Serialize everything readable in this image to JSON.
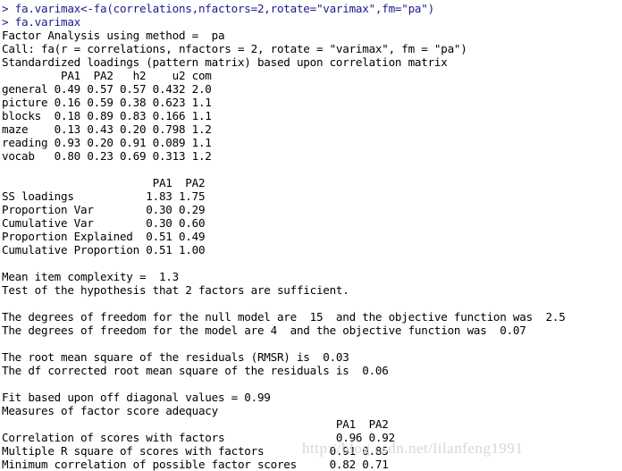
{
  "console": {
    "background_color": "#ffffff",
    "prompt_color": "#1a1a8c",
    "output_color": "#000000",
    "lines": [
      {
        "text": "> fa.varimax<-fa(correlations,nfactors=2,rotate=\"varimax\",fm=\"pa\")",
        "type": "prompt"
      },
      {
        "text": "> fa.varimax",
        "type": "prompt"
      },
      {
        "text": "Factor Analysis using method =  pa",
        "type": "output"
      },
      {
        "text": "Call: fa(r = correlations, nfactors = 2, rotate = \"varimax\", fm = \"pa\")",
        "type": "output"
      },
      {
        "text": "Standardized loadings (pattern matrix) based upon correlation matrix",
        "type": "output"
      },
      {
        "text": "         PA1  PA2   h2    u2 com",
        "type": "output"
      },
      {
        "text": "general 0.49 0.57 0.57 0.432 2.0",
        "type": "output"
      },
      {
        "text": "picture 0.16 0.59 0.38 0.623 1.1",
        "type": "output"
      },
      {
        "text": "blocks  0.18 0.89 0.83 0.166 1.1",
        "type": "output"
      },
      {
        "text": "maze    0.13 0.43 0.20 0.798 1.2",
        "type": "output"
      },
      {
        "text": "reading 0.93 0.20 0.91 0.089 1.1",
        "type": "output"
      },
      {
        "text": "vocab   0.80 0.23 0.69 0.313 1.2",
        "type": "output"
      },
      {
        "text": "",
        "type": "blank"
      },
      {
        "text": "                       PA1  PA2",
        "type": "output"
      },
      {
        "text": "SS loadings           1.83 1.75",
        "type": "output"
      },
      {
        "text": "Proportion Var        0.30 0.29",
        "type": "output"
      },
      {
        "text": "Cumulative Var        0.30 0.60",
        "type": "output"
      },
      {
        "text": "Proportion Explained  0.51 0.49",
        "type": "output"
      },
      {
        "text": "Cumulative Proportion 0.51 1.00",
        "type": "output"
      },
      {
        "text": "",
        "type": "blank"
      },
      {
        "text": "Mean item complexity =  1.3",
        "type": "output"
      },
      {
        "text": "Test of the hypothesis that 2 factors are sufficient.",
        "type": "output"
      },
      {
        "text": "",
        "type": "blank"
      },
      {
        "text": "The degrees of freedom for the null model are  15  and the objective function was  2.5",
        "type": "output"
      },
      {
        "text": "The degrees of freedom for the model are 4  and the objective function was  0.07",
        "type": "output"
      },
      {
        "text": "",
        "type": "blank"
      },
      {
        "text": "The root mean square of the residuals (RMSR) is  0.03",
        "type": "output"
      },
      {
        "text": "The df corrected root mean square of the residuals is  0.06",
        "type": "output"
      },
      {
        "text": "",
        "type": "blank"
      },
      {
        "text": "Fit based upon off diagonal values = 0.99",
        "type": "output"
      },
      {
        "text": "Measures of factor score adequacy",
        "type": "output"
      },
      {
        "text": "                                                   PA1  PA2",
        "type": "output"
      },
      {
        "text": "Correlation of scores with factors                 0.96 0.92",
        "type": "output"
      },
      {
        "text": "Multiple R square of scores with factors          0.91 0.85",
        "type": "output"
      },
      {
        "text": "Minimum correlation of possible factor scores     0.82 0.71",
        "type": "output"
      }
    ]
  },
  "watermark": {
    "text": "http://blog.csdn.net/lilanfeng1991",
    "color": "#d7d7d7"
  },
  "analysis_data": {
    "method": "pa",
    "nfactors": 2,
    "rotation": "varimax",
    "loadings_columns": [
      "PA1",
      "PA2",
      "h2",
      "u2",
      "com"
    ],
    "loadings_rows": [
      {
        "variable": "general",
        "PA1": 0.49,
        "PA2": 0.57,
        "h2": 0.57,
        "u2": 0.432,
        "com": 2.0
      },
      {
        "variable": "picture",
        "PA1": 0.16,
        "PA2": 0.59,
        "h2": 0.38,
        "u2": 0.623,
        "com": 1.1
      },
      {
        "variable": "blocks",
        "PA1": 0.18,
        "PA2": 0.89,
        "h2": 0.83,
        "u2": 0.166,
        "com": 1.1
      },
      {
        "variable": "maze",
        "PA1": 0.13,
        "PA2": 0.43,
        "h2": 0.2,
        "u2": 0.798,
        "com": 1.2
      },
      {
        "variable": "reading",
        "PA1": 0.93,
        "PA2": 0.2,
        "h2": 0.91,
        "u2": 0.089,
        "com": 1.1
      },
      {
        "variable": "vocab",
        "PA1": 0.8,
        "PA2": 0.23,
        "h2": 0.69,
        "u2": 0.313,
        "com": 1.2
      }
    ],
    "variance_table": [
      {
        "label": "SS loadings",
        "PA1": 1.83,
        "PA2": 1.75
      },
      {
        "label": "Proportion Var",
        "PA1": 0.3,
        "PA2": 0.29
      },
      {
        "label": "Cumulative Var",
        "PA1": 0.3,
        "PA2": 0.6
      },
      {
        "label": "Proportion Explained",
        "PA1": 0.51,
        "PA2": 0.49
      },
      {
        "label": "Cumulative Proportion",
        "PA1": 0.51,
        "PA2": 1.0
      }
    ],
    "mean_item_complexity": 1.3,
    "null_model_df": 15,
    "null_model_objective": 2.5,
    "model_df": 4,
    "model_objective": 0.07,
    "rmsr": 0.03,
    "df_corrected_rmsr": 0.06,
    "fit_off_diagonal": 0.99,
    "score_adequacy": [
      {
        "label": "Correlation of scores with factors",
        "PA1": 0.96,
        "PA2": 0.92
      },
      {
        "label": "Multiple R square of scores with factors",
        "PA1": 0.91,
        "PA2": 0.85
      },
      {
        "label": "Minimum correlation of possible factor scores",
        "PA1": 0.82,
        "PA2": 0.71
      }
    ]
  }
}
